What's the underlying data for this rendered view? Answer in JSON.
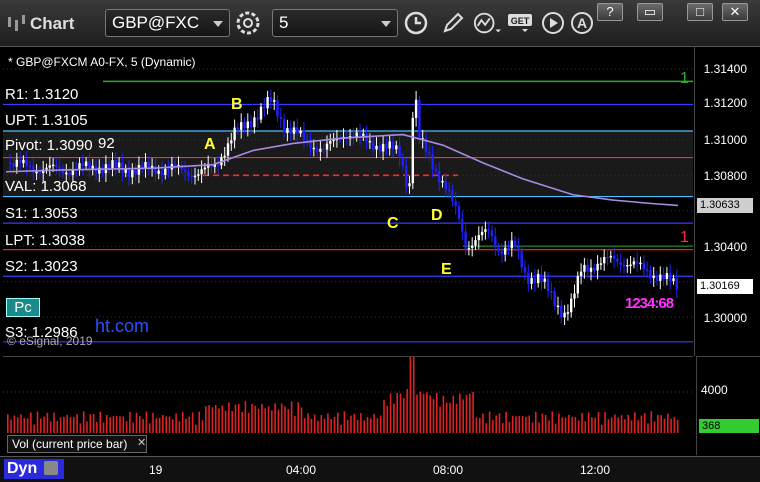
{
  "window": {
    "title": "Chart",
    "symbol": "GBP@FXC",
    "interval": "5",
    "buttons": [
      "?",
      "▭",
      "□",
      "✕"
    ]
  },
  "chart": {
    "header": "* GBP@FXCM A0-FX, 5 (Dynamic)",
    "levels": [
      {
        "label": "R1: 1.3120",
        "value": 1.312,
        "color": "#3a3aff"
      },
      {
        "label": "UPT: 1.3105",
        "value": 1.3105,
        "color": "#4dc0ff"
      },
      {
        "label": "Pivot: 1.3090",
        "value": 1.309,
        "color": "#ff2a2a"
      },
      {
        "label": "VAL: 1.3068",
        "value": 1.3068,
        "color": "#4dc0ff"
      },
      {
        "label": "S1: 1.3053",
        "value": 1.3053,
        "color": "#3a3aff"
      },
      {
        "label": "LPT: 1.3038",
        "value": 1.3038,
        "color": "#ff2a2a"
      },
      {
        "label": "S2: 1.3023",
        "value": 1.3023,
        "color": "#3a3aff"
      },
      {
        "label": "S3: 1.2986",
        "value": 1.2986,
        "color": "#3a3aff"
      }
    ],
    "pivot_suffix": "92",
    "pc_button": "Pc",
    "watermark": "eSignal, 2019",
    "watermark_site": "ht.com",
    "fib_labels": [
      "A",
      "B",
      "C",
      "D",
      "E"
    ],
    "price_ticks": [
      "1.31400",
      "1.31200",
      "1.31000",
      "1.30800",
      "1.30400",
      "1.30000"
    ],
    "price_boxes": [
      {
        "text": "1.30633",
        "bg": "#cfcfcf",
        "fg": "#000"
      },
      {
        "text": "1.30169",
        "bg": "#ffffff",
        "fg": "#000"
      }
    ],
    "line_markers": [
      "1",
      "1"
    ],
    "tick_annotation": "1234:68",
    "x_ticks": [
      "19",
      "04:00",
      "08:00",
      "12:00"
    ],
    "colors": {
      "up_candle": "#ffffff",
      "down_candle": "#2020ff",
      "ma_line": "#a78be0",
      "top_green_line": "#2ea82e",
      "volume": "#dd2222"
    }
  },
  "volume": {
    "label": "Vol (current price bar)",
    "tick": "4000",
    "current_box": "368"
  },
  "bottom": {
    "mode": "Dyn"
  }
}
